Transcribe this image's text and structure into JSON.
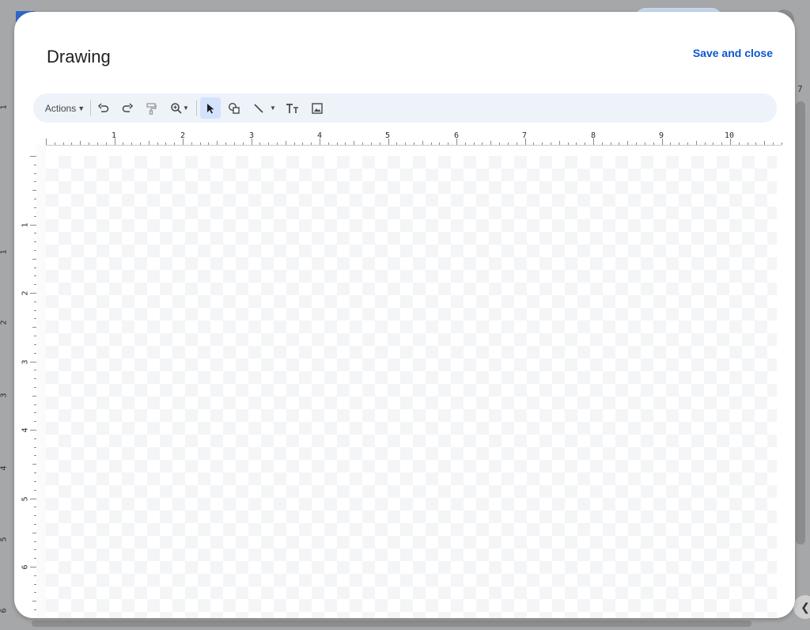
{
  "background": {
    "left_ruler_numbers": [
      "1",
      "1",
      "2",
      "3",
      "4",
      "5",
      "6"
    ],
    "right_ruler_number": "7"
  },
  "dialog": {
    "title": "Drawing",
    "save_label": "Save and close"
  },
  "toolbar": {
    "actions_label": "Actions",
    "buttons": [
      {
        "name": "undo-icon"
      },
      {
        "name": "redo-icon"
      },
      {
        "name": "paint-format-icon"
      },
      {
        "name": "zoom-icon"
      },
      {
        "name": "select-icon",
        "active": true
      },
      {
        "name": "shape-icon"
      },
      {
        "name": "line-icon"
      },
      {
        "name": "text-box-icon"
      },
      {
        "name": "image-icon"
      }
    ]
  },
  "rulers": {
    "horizontal": [
      "1",
      "2",
      "3",
      "4",
      "5",
      "6",
      "7",
      "8",
      "9",
      "10"
    ],
    "vertical": [
      "1",
      "2",
      "3",
      "4",
      "5",
      "6"
    ]
  },
  "colors": {
    "accent": "#0b57d0",
    "toolbar_bg": "#eef2f9",
    "active_tool_bg": "#d3e3fd"
  }
}
